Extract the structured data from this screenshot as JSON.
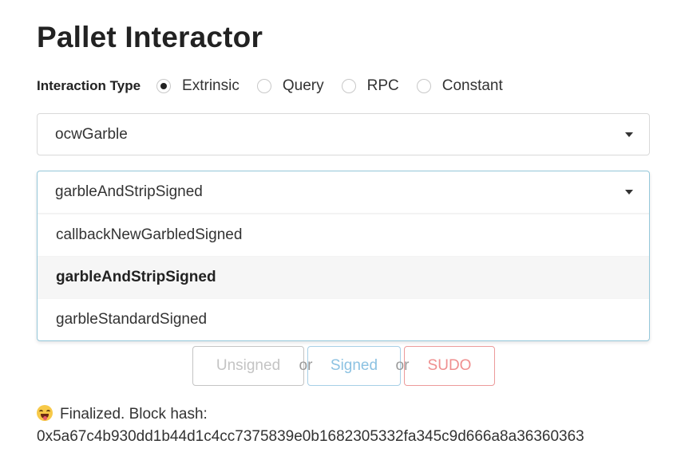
{
  "page": {
    "title": "Pallet Interactor"
  },
  "interaction": {
    "label": "Interaction Type",
    "options": [
      "Extrinsic",
      "Query",
      "RPC",
      "Constant"
    ],
    "selected": "Extrinsic"
  },
  "pallet_select": {
    "value": "ocwGarble"
  },
  "call_select": {
    "value": "garbleAndStripSigned",
    "options": [
      "callbackNewGarbledSigned",
      "garbleAndStripSigned",
      "garbleStandardSigned"
    ],
    "selected": "garbleAndStripSigned"
  },
  "buttons": {
    "unsigned": "Unsigned",
    "or1": "or",
    "signed": "Signed",
    "or2": "or",
    "sudo": "SUDO"
  },
  "status": {
    "icon": "grinning-tongue-emoji",
    "line1": "Finalized. Block hash:",
    "line2": "0x5a67c4b930dd1b44d1c4cc7375839e0b1682305332fa345c9d666a8a36360363"
  },
  "colors": {
    "signed": "#8cc2e2",
    "sudo": "#ef8f8f",
    "unsigned": "#c4c4c4",
    "focus_border": "#96c8da"
  }
}
